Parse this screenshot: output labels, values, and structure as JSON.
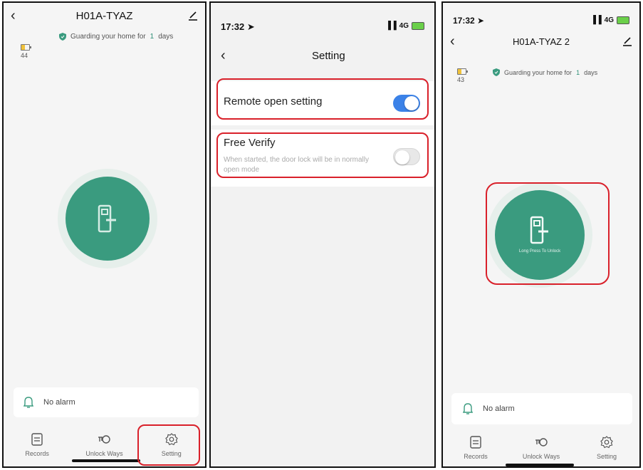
{
  "screen1": {
    "title": "H01A-TYAZ",
    "battery_level": "44",
    "guard_text": "Guarding your home for",
    "guard_days": "1",
    "guard_unit": "days",
    "alarm_text": "No alarm",
    "tabs": [
      {
        "label": "Records",
        "icon": "records-icon"
      },
      {
        "label": "Unlock Ways",
        "icon": "key-icon"
      },
      {
        "label": "Setting",
        "icon": "gear-icon"
      }
    ]
  },
  "screen2": {
    "time": "17:32",
    "network": "4G",
    "title": "Setting",
    "remote_open": {
      "label": "Remote open setting",
      "enabled": true
    },
    "free_verify": {
      "label": "Free Verify",
      "description": "When started, the door lock will be in normally open mode",
      "enabled": false
    }
  },
  "screen3": {
    "time": "17:32",
    "network": "4G",
    "title": "H01A-TYAZ 2",
    "battery_level": "43",
    "guard_text": "Guarding your home for",
    "guard_days": "1",
    "guard_unit": "days",
    "lock_caption": "Long Press To Unlock",
    "alarm_text": "No alarm",
    "tabs": [
      {
        "label": "Records",
        "icon": "records-icon"
      },
      {
        "label": "Unlock Ways",
        "icon": "key-icon"
      },
      {
        "label": "Setting",
        "icon": "gear-icon"
      }
    ]
  },
  "colors": {
    "accent_green": "#3a9b7f",
    "toggle_blue": "#3b82e8",
    "highlight_red": "#d9202a"
  }
}
